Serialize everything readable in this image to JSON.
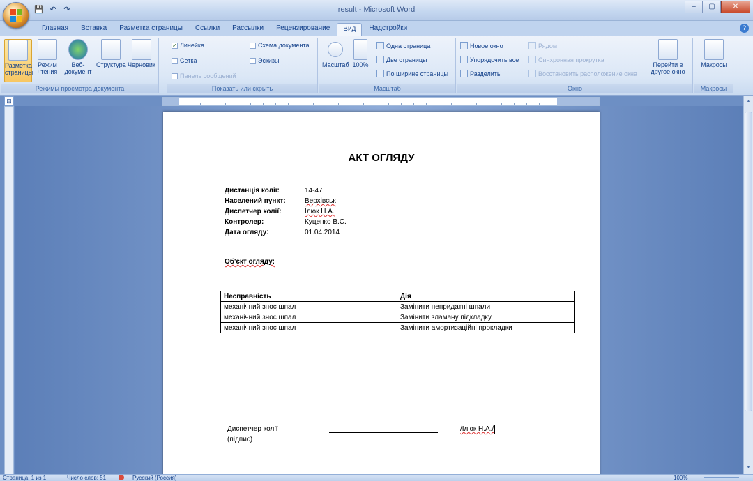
{
  "window": {
    "title": "result - Microsoft Word"
  },
  "qat": {
    "save_icon": "💾",
    "undo_icon": "↶",
    "redo_icon": "↷"
  },
  "tabs": [
    "Главная",
    "Вставка",
    "Разметка страницы",
    "Ссылки",
    "Рассылки",
    "Рецензирование",
    "Вид",
    "Надстройки"
  ],
  "active_tab": "Вид",
  "ribbon": {
    "view_modes": {
      "label": "Режимы просмотра документа",
      "buttons": [
        {
          "label": "Разметка страницы",
          "active": true
        },
        {
          "label": "Режим чтения",
          "active": false
        },
        {
          "label": "Веб-документ",
          "active": false
        },
        {
          "label": "Структура",
          "active": false
        },
        {
          "label": "Черновик",
          "active": false
        }
      ]
    },
    "show_hide": {
      "label": "Показать или скрыть",
      "items": [
        {
          "label": "Линейка",
          "checked": true,
          "enabled": true
        },
        {
          "label": "Сетка",
          "checked": false,
          "enabled": true
        },
        {
          "label": "Панель сообщений",
          "checked": false,
          "enabled": false
        },
        {
          "label": "Схема документа",
          "checked": false,
          "enabled": true
        },
        {
          "label": "Эскизы",
          "checked": false,
          "enabled": true
        }
      ]
    },
    "zoom": {
      "label": "Масштаб",
      "zoom_button": "Масштаб",
      "hundred_button": "100%",
      "one_page": "Одна страница",
      "two_pages": "Две страницы",
      "page_width": "По ширине страницы"
    },
    "window": {
      "label": "Окно",
      "new_window": "Новое окно",
      "arrange_all": "Упорядочить все",
      "split": "Разделить",
      "side_by_side": "Рядом",
      "sync_scroll": "Синхронная прокрутка",
      "reset_position": "Восстановить расположение окна",
      "switch_windows": "Перейти в другое окно"
    },
    "macros": {
      "label": "Макросы",
      "button": "Макросы"
    }
  },
  "document": {
    "title": "АКТ ОГЛЯДУ",
    "fields": [
      {
        "label": "Дистанція колії:",
        "value": "14-47"
      },
      {
        "label": "Населений пункт:",
        "value": "Верхівськ"
      },
      {
        "label": "Диспетчер колії:",
        "value": "Ілюк Н.А."
      },
      {
        "label": "Контролер:",
        "value": "Куценко В.С."
      },
      {
        "label": "Дата огляду:",
        "value": "01.04.2014"
      }
    ],
    "object_label": "Об'єкт огляду:",
    "table": {
      "headers": [
        "Несправність",
        "Дія"
      ],
      "rows": [
        [
          "механічний знос шпал",
          "Замінити непридатні шпали"
        ],
        [
          "механічний знос шпал",
          "Замінити зламану підкладку"
        ],
        [
          "механічний знос шпал",
          "Замінити амортизаційні прокладки"
        ]
      ]
    },
    "signature": {
      "role": "Диспетчер колії",
      "note": "(підпис)",
      "name": "/Ілюк Н.А./"
    }
  },
  "status": {
    "page": "Страница: 1 из 1",
    "words": "Число слов: 51",
    "language": "Русский (Россия)",
    "zoom": "100%"
  }
}
